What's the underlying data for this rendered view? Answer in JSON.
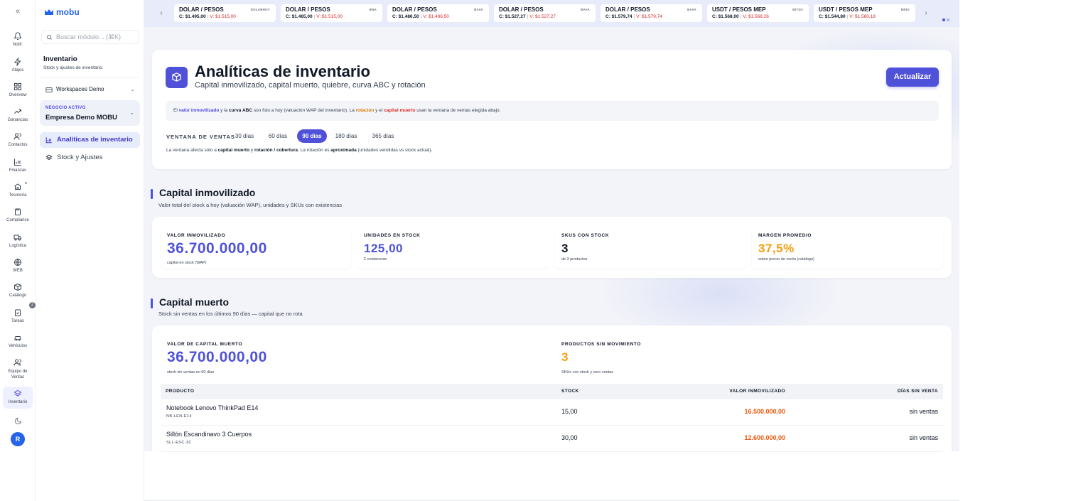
{
  "rail": {
    "items": [
      {
        "label": "Notif.",
        "icon": "bell-icon"
      },
      {
        "label": "Atajos",
        "icon": "lightning-icon"
      },
      {
        "label": "Overview",
        "icon": "grid-icon"
      },
      {
        "label": "Ganancias",
        "icon": "trend-icon"
      },
      {
        "label": "Contactos",
        "icon": "users-icon"
      },
      {
        "label": "Finanzas",
        "icon": "bar-chart-icon"
      },
      {
        "label": "Tesorería",
        "icon": "bank-icon"
      },
      {
        "label": "Compliance",
        "icon": "clipboard-icon"
      },
      {
        "label": "Logística",
        "icon": "truck-icon"
      },
      {
        "label": "WEB",
        "icon": "globe-icon"
      },
      {
        "label": "Catálogo",
        "icon": "box-icon"
      },
      {
        "label": "Tareas",
        "icon": "clipboard-check-icon"
      },
      {
        "label": "Vehículos",
        "icon": "car-icon"
      },
      {
        "label": "Equipo de Ventas",
        "icon": "team-icon"
      },
      {
        "label": "Inventario",
        "icon": "layers-icon"
      }
    ],
    "catalog_badge": "2",
    "avatar_initial": "R"
  },
  "sidebar": {
    "logo_text": "mobu",
    "search_placeholder": "Buscar módulo... (⌘K)",
    "title": "Inventario",
    "subtitle": "Stock y ajustes de inventario.",
    "workspace": "Workspaces Demo",
    "negocio_label": "NEGOCIO ACTIVO",
    "negocio_value": "Empresa Demo MOBU",
    "nav": [
      {
        "label": "Analíticas de inventario",
        "active": true
      },
      {
        "label": "Stock y Ajustes",
        "active": false
      }
    ]
  },
  "ticker": [
    {
      "title": "DOLAR / PESOS",
      "source": "DOLARHOY",
      "c": "C: $1.495,00",
      "v": "V: $1.515,00"
    },
    {
      "title": "DOLAR / PESOS",
      "source": "BNA",
      "c": "C: $1.465,00",
      "v": "V: $1.515,00"
    },
    {
      "title": "DOLAR / PESOS",
      "source": "BAVA",
      "c": "C: $1.486,50",
      "v": "V: $1.486,50"
    },
    {
      "title": "DOLAR / PESOS",
      "source": "BAVA",
      "c": "C: $1.527,27",
      "v": "V: $1.527,27"
    },
    {
      "title": "DOLAR / PESOS",
      "source": "BAVA",
      "c": "C: $1.579,74",
      "v": "V: $1.579,74"
    },
    {
      "title": "USDT / PESOS MEP",
      "source": "BITSO",
      "c": "C: $1.568,00",
      "v": "V: $1.568,26"
    },
    {
      "title": "USDT / PESOS MEP",
      "source": "BRIO",
      "c": "C: $1.544,80",
      "v": "V: $1.580,18"
    }
  ],
  "header": {
    "title": "Analíticas de inventario",
    "subtitle": "Capital inmovilizado, capital muerto, quiebre, curva ABC y rotación",
    "action": "Actualizar"
  },
  "note": {
    "p1": "El ",
    "b1": "valor inmovilizado",
    "p2": " y la ",
    "b2": "curva ABC",
    "p3": " son foto a hoy (valuación WAP del inventario). La ",
    "b3": "rotación",
    "p4": " y el ",
    "b4": "capital muerto",
    "p5": " usan la ventana de ventas elegida abajo."
  },
  "window": {
    "label": "VENTANA DE VENTAS",
    "options": [
      "30 días",
      "60 días",
      "90 días",
      "180 días",
      "365 días"
    ],
    "selected": "90 días",
    "note_p1": "La ventana afecta sólo a ",
    "note_b1": "capital muerto",
    "note_p2": " y ",
    "note_b2": "rotación / cobertura",
    "note_p3": ". La rotación es ",
    "note_b3": "aproximada",
    "note_p4": " (unidades vendidas vs stock actual)."
  },
  "capital_inmovilizado": {
    "title": "Capital inmovilizado",
    "subtitle": "Valor total del stock a hoy (valuación WAP), unidades y SKUs con existencias",
    "kpis": [
      {
        "label": "VALOR INMOVILIZADO",
        "value": "36.700.000,00",
        "sub": "capital en stock (WAP)"
      },
      {
        "label": "UNIDADES EN STOCK",
        "value": "125,00",
        "sub": "Σ existencias"
      },
      {
        "label": "SKUS CON STOCK",
        "value": "3",
        "sub": "de 3 productos"
      },
      {
        "label": "MARGEN PROMEDIO",
        "value": "37,5%",
        "sub": "sobre precio de venta (catálogo)"
      }
    ]
  },
  "capital_muerto": {
    "title": "Capital muerto",
    "subtitle": "Stock sin ventas en los últimos 90 días — capital que no rota",
    "kpis": [
      {
        "label": "VALOR DE CAPITAL MUERTO",
        "value": "36.700.000,00",
        "sub": "stock sin ventas en 90 días"
      },
      {
        "label": "PRODUCTOS SIN MOVIMIENTO",
        "value": "3",
        "sub": "SKUs con stock y cero ventas"
      }
    ],
    "table": {
      "columns": [
        "PRODUCTO",
        "STOCK",
        "VALOR INMOVILIZADO",
        "DÍAS SIN VENTA"
      ],
      "rows": [
        {
          "producto": "Notebook Lenovo ThinkPad E14",
          "sku": "NB-LEN-E14",
          "stock": "15,00",
          "valor": "16.500.000,00",
          "dias": "sin ventas"
        },
        {
          "producto": "Sillón Escandinavo 3 Cuerpos",
          "sku": "SLL-ESC-3C",
          "stock": "30,00",
          "valor": "12.600.000,00",
          "dias": "sin ventas"
        }
      ]
    }
  },
  "colors": {
    "accent": "#4f52d8",
    "orange": "#f59e0b",
    "red": "#dc2626"
  }
}
